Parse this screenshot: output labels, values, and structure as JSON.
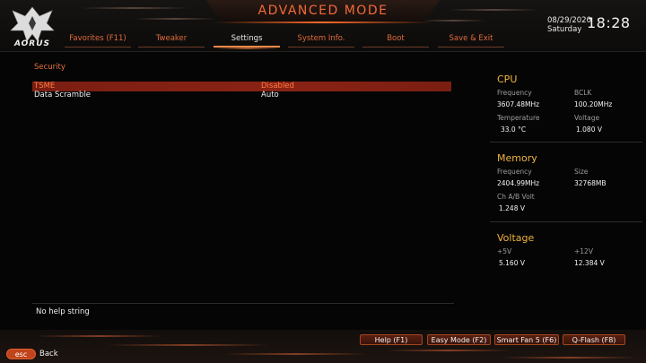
{
  "header": {
    "title": "ADVANCED MODE",
    "logo_text": "AORUS",
    "date": "08/29/2020",
    "day": "Saturday",
    "time": "18:28"
  },
  "tabs": [
    {
      "label": "Favorites (F11)",
      "active": false
    },
    {
      "label": "Tweaker",
      "active": false
    },
    {
      "label": "Settings",
      "active": true
    },
    {
      "label": "System Info.",
      "active": false
    },
    {
      "label": "Boot",
      "active": false
    },
    {
      "label": "Save & Exit",
      "active": false
    }
  ],
  "main": {
    "section_title": "Security",
    "settings": [
      {
        "label": "TSME",
        "value": "Disabled",
        "selected": true
      },
      {
        "label": "Data Scramble",
        "value": "Auto",
        "selected": false
      }
    ],
    "help_text": "No help string"
  },
  "hardware": {
    "cpu": {
      "title": "CPU",
      "frequency_label": "Frequency",
      "frequency_value": "3607.48MHz",
      "bclk_label": "BCLK",
      "bclk_value": "100.20MHz",
      "temperature_label": "Temperature",
      "temperature_value": "33.0 °C",
      "voltage_label": "Voltage",
      "voltage_value": "1.080 V"
    },
    "memory": {
      "title": "Memory",
      "frequency_label": "Frequency",
      "frequency_value": "2404.99MHz",
      "size_label": "Size",
      "size_value": "32768MB",
      "volt_label": "Ch A/B Volt",
      "volt_value": "1.248 V"
    },
    "voltage": {
      "title": "Voltage",
      "p5v_label": "+5V",
      "p5v_value": "5.160 V",
      "p12v_label": "+12V",
      "p12v_value": "12.384 V"
    }
  },
  "footer": {
    "buttons": [
      {
        "label": "Help (F1)"
      },
      {
        "label": "Easy Mode (F2)"
      },
      {
        "label": "Smart Fan 5 (F6)"
      },
      {
        "label": "Q-Flash (F8)"
      }
    ],
    "esc_label": "esc",
    "back_label": "Back"
  },
  "colors": {
    "accent": "#e5703f",
    "hw_title": "#f0b43c",
    "selected_row": "#8a2314"
  }
}
